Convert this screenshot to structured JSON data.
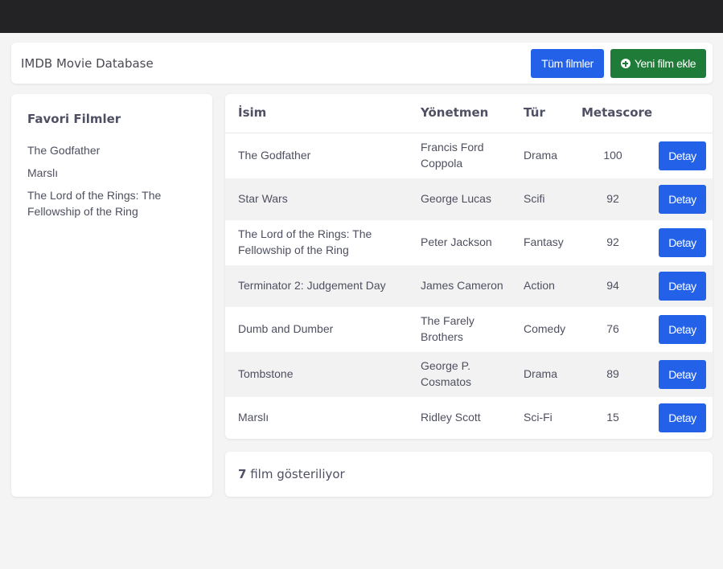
{
  "header": {
    "title": "IMDB Movie Database",
    "all_films_label": "Tüm filmler",
    "new_film_label": "Yeni film ekle",
    "new_film_icon": "plus-circle-icon"
  },
  "sidebar": {
    "title": "Favori Filmler",
    "items": [
      {
        "label": "The Godfather"
      },
      {
        "label": "Marslı"
      },
      {
        "label": "The Lord of the Rings: The Fellowship of the Ring"
      }
    ]
  },
  "table": {
    "headers": {
      "name": "İsim",
      "director": "Yönetmen",
      "genre": "Tür",
      "metascore": "Metascore"
    },
    "detail_label": "Detay",
    "rows": [
      {
        "name": "The Godfather",
        "director": "Francis Ford Coppola",
        "genre": "Drama",
        "metascore": "100"
      },
      {
        "name": "Star Wars",
        "director": "George Lucas",
        "genre": "Scifi",
        "metascore": "92"
      },
      {
        "name": "The Lord of the Rings: The Fellowship of the Ring",
        "director": "Peter Jackson",
        "genre": "Fantasy",
        "metascore": "92"
      },
      {
        "name": "Terminator 2: Judgement Day",
        "director": "James Cameron",
        "genre": "Action",
        "metascore": "94"
      },
      {
        "name": "Dumb and Dumber",
        "director": "The Farely Brothers",
        "genre": "Comedy",
        "metascore": "76"
      },
      {
        "name": "Tombstone",
        "director": "George P. Cosmatos",
        "genre": "Drama",
        "metascore": "89"
      },
      {
        "name": "Marslı",
        "director": "Ridley Scott",
        "genre": "Sci-Fi",
        "metascore": "15"
      }
    ]
  },
  "footer": {
    "count": "7",
    "text": "film gösteriliyor"
  },
  "colors": {
    "primary": "#2361e8",
    "success": "#1e7c38",
    "topbar": "#232326",
    "background": "#f4f4f4"
  }
}
